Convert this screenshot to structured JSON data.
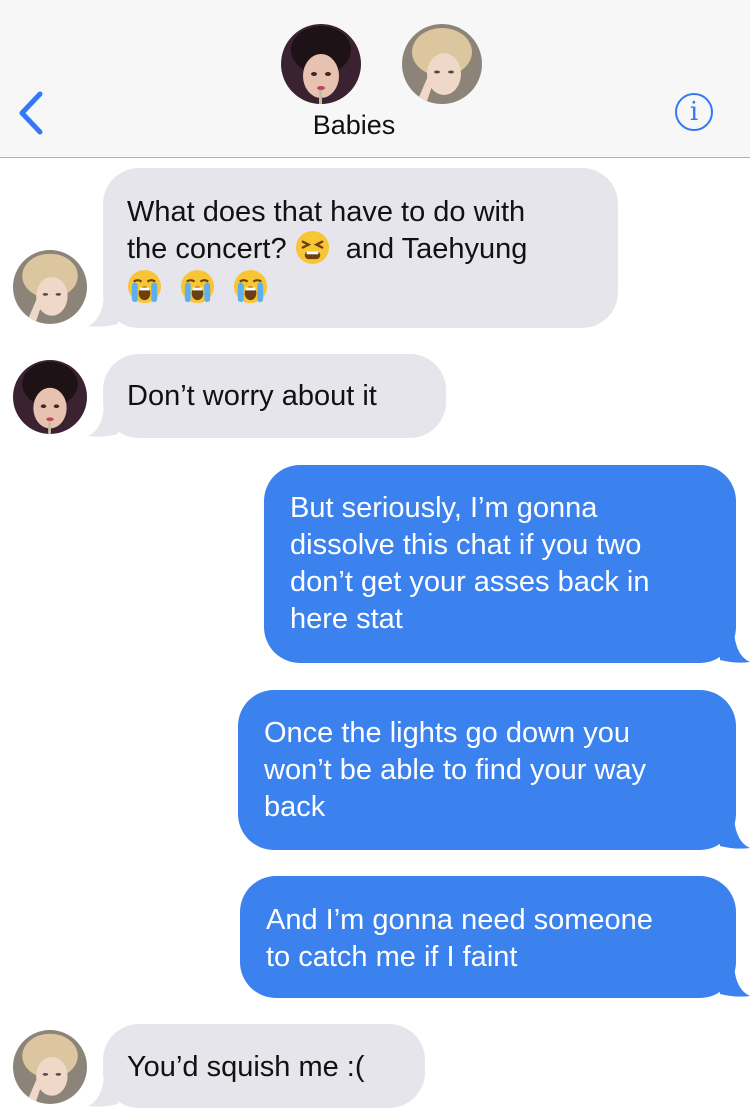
{
  "header": {
    "back_icon": "chevron-left-icon",
    "group_name": "Babies",
    "info_icon": "info-icon",
    "info_glyph": "i"
  },
  "colors": {
    "incoming_bubble": "#e6e5eb",
    "outgoing_bubble": "#3b82ee",
    "accent": "#3478f6"
  },
  "messages": [
    {
      "direction": "incoming",
      "line1": "What does that have to do with",
      "line2a": "the concert?",
      "line2b": "and Taehyung",
      "emojis": [
        "tired-face-emoji",
        "loudly-crying-face-emoji",
        "loudly-crying-face-emoji",
        "loudly-crying-face-emoji"
      ]
    },
    {
      "direction": "incoming",
      "text": "Don’t worry about it"
    },
    {
      "direction": "outgoing",
      "lines": [
        "But seriously, I’m gonna",
        "dissolve this chat if you two",
        "don’t get your asses back in",
        "here stat"
      ]
    },
    {
      "direction": "outgoing",
      "lines": [
        "Once the lights go down you",
        "won’t be able to find your way",
        "back"
      ]
    },
    {
      "direction": "outgoing",
      "lines": [
        "And I’m gonna need someone",
        "to catch me if I faint"
      ]
    },
    {
      "direction": "incoming",
      "text": "You’d squish me :("
    }
  ]
}
